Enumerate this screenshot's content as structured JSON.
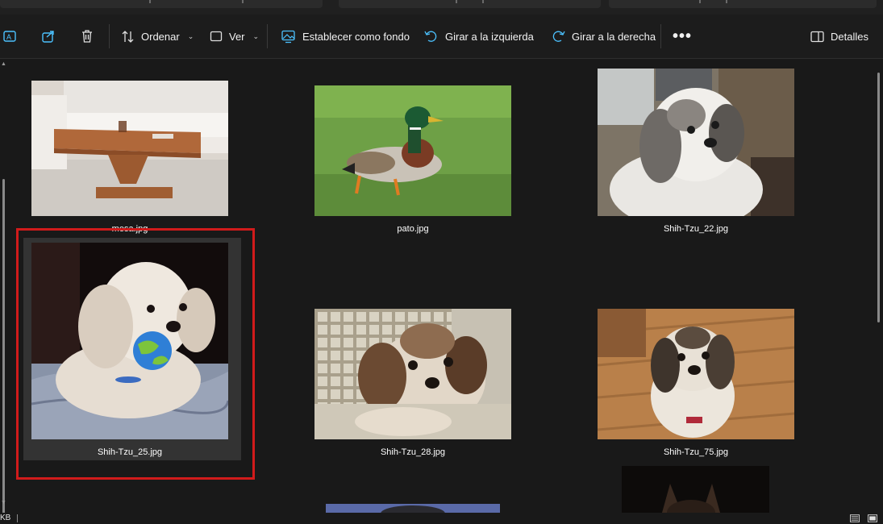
{
  "toolbar": {
    "sort_label": "Ordenar",
    "view_label": "Ver",
    "set_background_label": "Establecer como fondo",
    "rotate_left_label": "Girar a la izquierda",
    "rotate_right_label": "Girar a la derecha",
    "more_label": "•••",
    "details_label": "Detalles"
  },
  "files": [
    {
      "name": "mesa.jpg",
      "visible_caption": "mesa.jpg"
    },
    {
      "name": "pato.jpg"
    },
    {
      "name": "Shih-Tzu_22.jpg"
    },
    {
      "name": "Shih-Tzu_25.jpg",
      "selected": true
    },
    {
      "name": "Shih-Tzu_28.jpg"
    },
    {
      "name": "Shih-Tzu_75.jpg"
    }
  ],
  "statusbar": {
    "size_fragment": "KB"
  },
  "colors": {
    "background": "#191919",
    "toolbar": "#1c1c1c",
    "highlight": "#d11b1b",
    "selection": "#333333",
    "accent_icon": "#4cc2ff"
  }
}
